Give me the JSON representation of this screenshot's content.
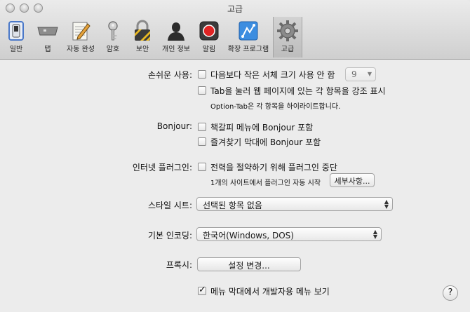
{
  "window": {
    "title": "고급"
  },
  "toolbar": {
    "items": [
      {
        "label": "일반",
        "icon": "general-switch-icon"
      },
      {
        "label": "탭",
        "icon": "tabs-icon"
      },
      {
        "label": "자동 완성",
        "icon": "autofill-pencil-icon"
      },
      {
        "label": "암호",
        "icon": "key-icon"
      },
      {
        "label": "보안",
        "icon": "lock-icon"
      },
      {
        "label": "개인 정보",
        "icon": "person-silhouette-icon"
      },
      {
        "label": "알림",
        "icon": "notification-record-icon"
      },
      {
        "label": "확장 프로그램",
        "icon": "extensions-puzzle-icon"
      },
      {
        "label": "고급",
        "icon": "gear-icon"
      }
    ],
    "active": "고급"
  },
  "accessibility": {
    "label": "손쉬운 사용:",
    "min_font_option": "다음보다 작은 서체 크기 사용 안 함",
    "min_font_size": "9",
    "tab_option": "Tab을 눌러 웹 페이지에 있는 각 항목을 강조 표시",
    "tab_hint": "Option-Tab은 각 항목을 하이라이트합니다."
  },
  "bonjour": {
    "label": "Bonjour:",
    "bookmarks_menu": "책갈피 메뉴에 Bonjour 포함",
    "favorites_bar": "즐겨찾기 막대에 Bonjour 포함"
  },
  "plugins": {
    "label": "인터넷 플러그인:",
    "stop_option": "전력을 절약하기 위해 플러그인 중단",
    "note": "1개의 사이트에서 플러그인 자동 시작",
    "details_button": "세부사항..."
  },
  "stylesheet": {
    "label": "스타일 시트:",
    "value": "선택된 항목 없음"
  },
  "encoding": {
    "label": "기본 인코딩:",
    "value": "한국어(Windows, DOS)"
  },
  "proxies": {
    "label": "프록시:",
    "button": "설정 변경..."
  },
  "develop": {
    "label": "메뉴 막대에서 개발자용 메뉴 보기",
    "checked": true
  },
  "help": {
    "label": "?"
  }
}
